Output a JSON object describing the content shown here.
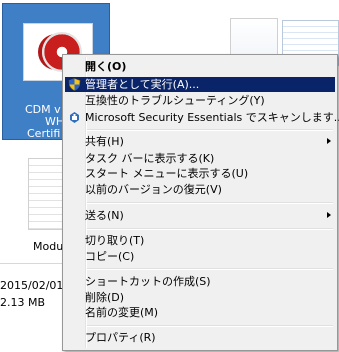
{
  "desktop": {
    "selected_item": {
      "label_lines": [
        "CDM v",
        "WH",
        "Certifi"
      ]
    },
    "module_label": "Modul",
    "details": {
      "date": "2015/02/01",
      "size": "2.13 MB"
    }
  },
  "context_menu": {
    "items": [
      {
        "label": "開く(O)"
      },
      {
        "label": "管理者として実行(A)...",
        "icon": "uac-shield-icon"
      },
      {
        "label": "互換性のトラブルシューティング(Y)"
      },
      {
        "label": "Microsoft Security Essentials でスキャンします...",
        "icon": "security-essentials-icon"
      },
      {
        "label": "共有(H)"
      },
      {
        "label": "タスク バーに表示する(K)"
      },
      {
        "label": "スタート メニューに表示する(U)"
      },
      {
        "label": "以前のバージョンの復元(V)"
      },
      {
        "label": "送る(N)"
      },
      {
        "label": "切り取り(T)"
      },
      {
        "label": "コピー(C)"
      },
      {
        "label": "ショートカットの作成(S)"
      },
      {
        "label": "削除(D)"
      },
      {
        "label": "名前の変更(M)"
      },
      {
        "label": "プロパティ(R)"
      }
    ]
  },
  "colors": {
    "highlight": "#0a246a",
    "selection_tile": "#3f7fc6"
  }
}
